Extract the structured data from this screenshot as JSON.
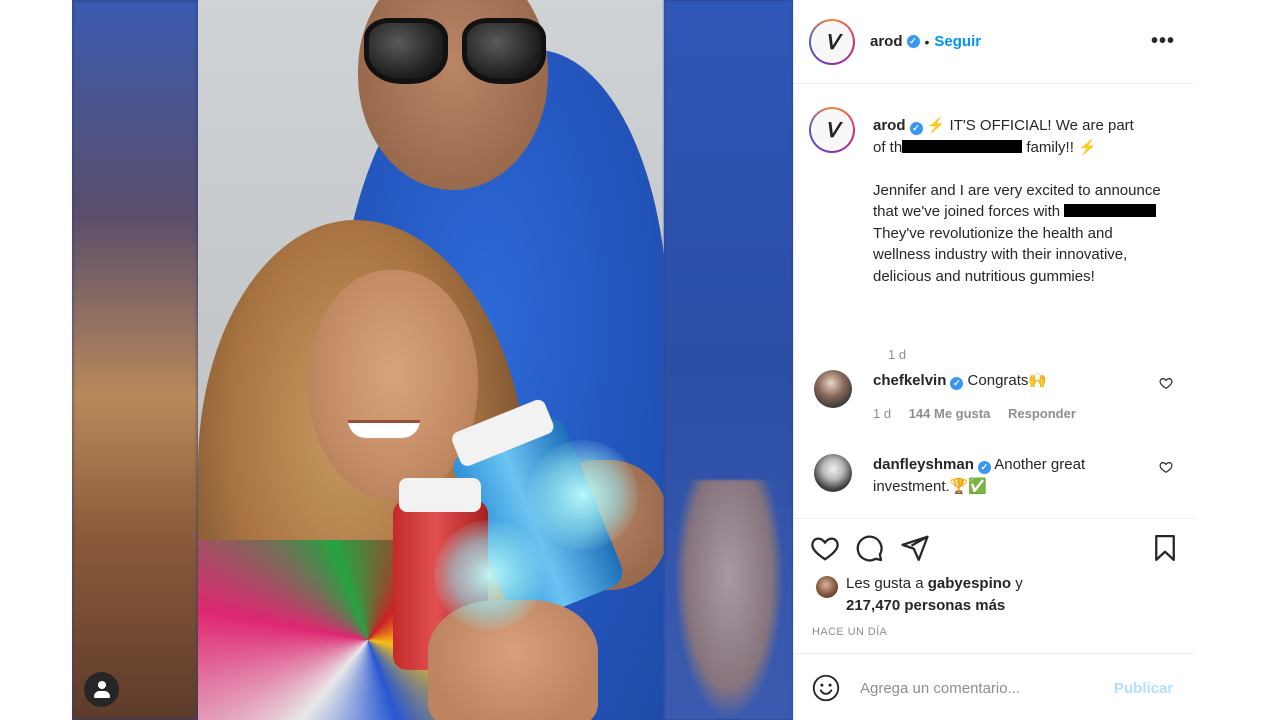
{
  "post": {
    "username": "arod",
    "follow_label": "Seguir",
    "more_label": "•••",
    "separator": "•",
    "avatar_letter": "ᐯ"
  },
  "caption": {
    "username": "arod",
    "line1": " IT'S OFFICIAL! We are part",
    "line2_pre": "of th",
    "line2_post": " family!! ",
    "para2_a": "Jennifer and I are very excited to announce that we've joined forces with",
    "para2_b": "They've revolutionize the health and wellness industry with their innovative, delicious and nutritious gummies!",
    "emoji": "⚡",
    "time": "1 d"
  },
  "comments": [
    {
      "username": "chefkelvin",
      "text": "Congrats",
      "emoji": "🙌",
      "time": "1 d",
      "likes": "144 Me gusta",
      "reply": "Responder"
    },
    {
      "username": "danfleyshman",
      "text": "Another great investment.",
      "emoji": "🏆✅"
    }
  ],
  "likes": {
    "prefix": "Les gusta a",
    "user": "gabyespino",
    "conj": "y",
    "count": "217,470 personas más"
  },
  "timestamp": "HACE UN DÍA",
  "add_comment": {
    "placeholder": "Agrega un comentario...",
    "publish_label": "Publicar"
  },
  "colors": {
    "link": "#0095f6",
    "verified": "#3897f0",
    "publish_disabled": "#b2dffc"
  },
  "icons": [
    "heart-icon",
    "comment-icon",
    "share-icon",
    "bookmark-icon",
    "emoji-icon",
    "user-tag-icon",
    "verified-icon",
    "more-icon"
  ]
}
